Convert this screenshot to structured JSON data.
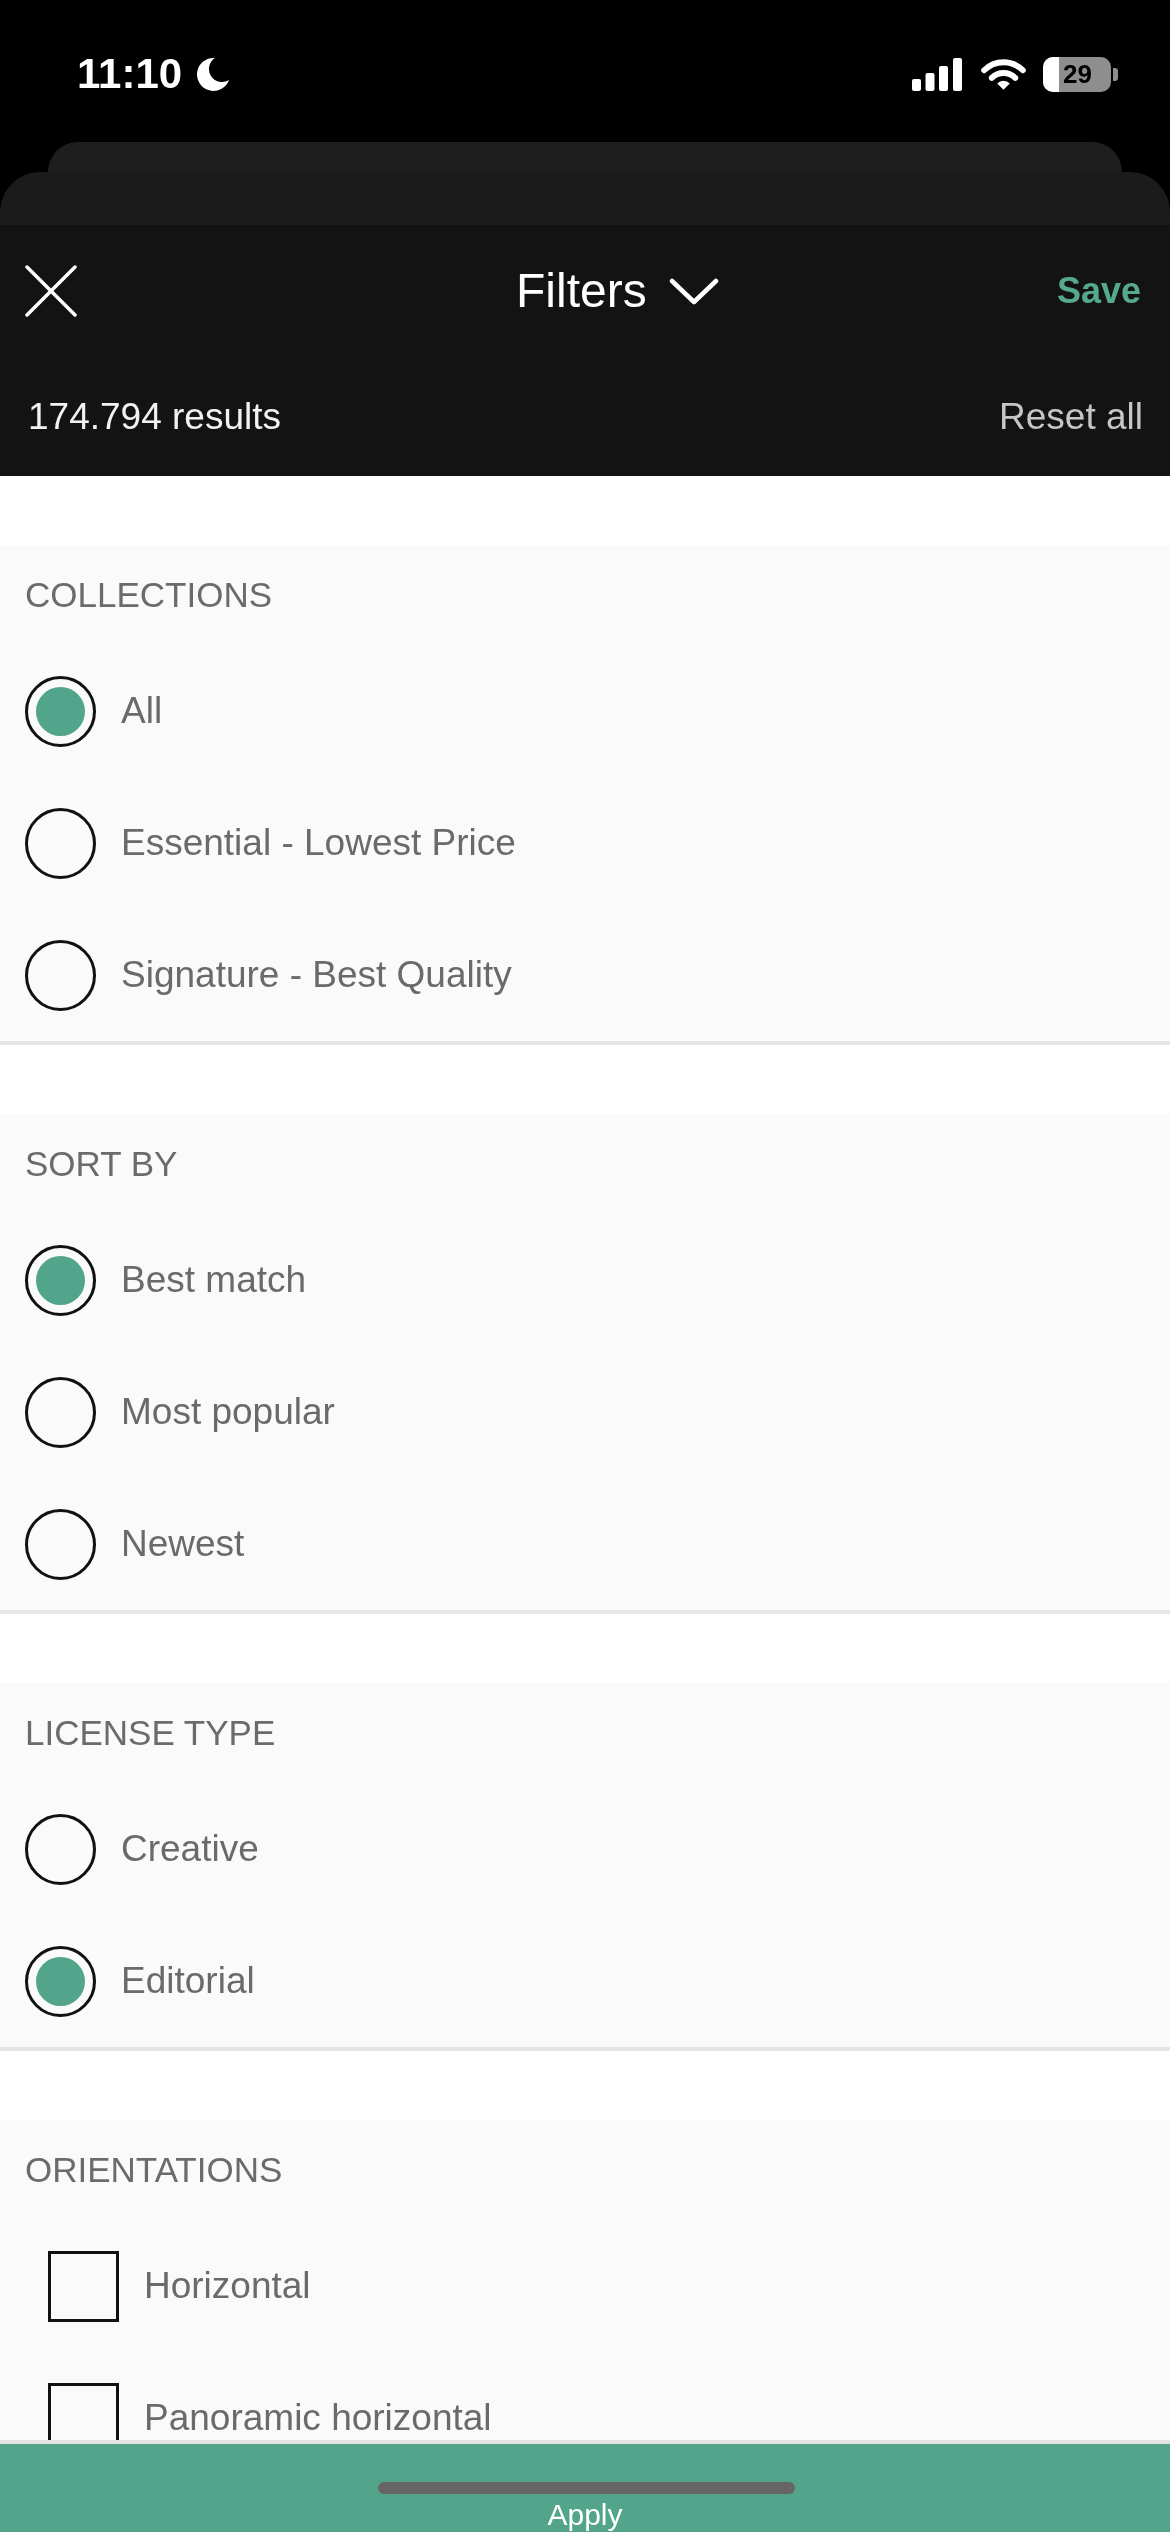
{
  "status_bar": {
    "time": "11:10",
    "battery": "29"
  },
  "header": {
    "title": "Filters",
    "save": "Save",
    "results": "174.794 results",
    "reset": "Reset all"
  },
  "sections": [
    {
      "heading": "COLLECTIONS",
      "kind": "radio",
      "options": [
        {
          "label": "All",
          "selected": true
        },
        {
          "label": "Essential - Lowest Price",
          "selected": false
        },
        {
          "label": "Signature - Best Quality",
          "selected": false
        }
      ]
    },
    {
      "heading": "SORT BY",
      "kind": "radio",
      "options": [
        {
          "label": "Best match",
          "selected": true
        },
        {
          "label": "Most popular",
          "selected": false
        },
        {
          "label": "Newest",
          "selected": false
        }
      ]
    },
    {
      "heading": "LICENSE TYPE",
      "kind": "radio",
      "options": [
        {
          "label": "Creative",
          "selected": false
        },
        {
          "label": "Editorial",
          "selected": true
        }
      ]
    },
    {
      "heading": "ORIENTATIONS",
      "kind": "checkbox",
      "options": [
        {
          "label": "Horizontal",
          "checked": false
        },
        {
          "label": "Panoramic horizontal",
          "checked": false
        }
      ]
    }
  ],
  "apply_button": {
    "label": "Apply"
  }
}
